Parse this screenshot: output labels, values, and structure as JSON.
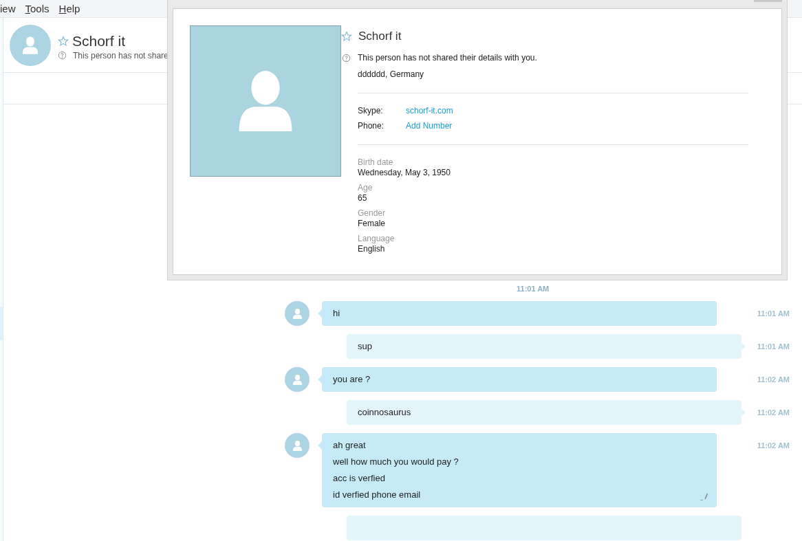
{
  "menu": [
    {
      "label": "iew",
      "mnemonic": false
    },
    {
      "label": "Tools",
      "mnemonic": true
    },
    {
      "label": "Help",
      "mnemonic": true
    }
  ],
  "contact_header": {
    "name": "Schorf it",
    "status": "This person has not share"
  },
  "profile_dialog": {
    "name": "Schorf it",
    "status": "This person has not shared their details with you.",
    "location": "dddddd, Germany",
    "accounts": [
      {
        "label": "Skype:",
        "value": "schorf-it.com"
      },
      {
        "label": "Phone:",
        "value": "Add Number"
      }
    ],
    "details": [
      {
        "label": "Birth date",
        "value": "Wednesday, May 3, 1950"
      },
      {
        "label": "Age",
        "value": "65"
      },
      {
        "label": "Gender",
        "value": "Female"
      },
      {
        "label": "Language",
        "value": "English"
      }
    ]
  },
  "chat": {
    "day_time": "11:01 AM",
    "messages": [
      {
        "kind": "incoming",
        "lines": [
          "hi"
        ],
        "time": "11:01 AM",
        "edited": false
      },
      {
        "kind": "outgoing",
        "lines": [
          "sup"
        ],
        "time": "11:01 AM",
        "edited": false
      },
      {
        "kind": "incoming",
        "lines": [
          "you are ?"
        ],
        "time": "11:02 AM",
        "edited": false
      },
      {
        "kind": "outgoing",
        "lines": [
          "coinnosaurus"
        ],
        "time": "11:02 AM",
        "edited": false
      },
      {
        "kind": "incoming",
        "lines": [
          "ah great",
          "well how much you would pay ?",
          "acc is verfied",
          "id verfied phone email"
        ],
        "time": "11:02 AM",
        "edited": true
      },
      {
        "kind": "outgoing",
        "edited": false
      }
    ]
  }
}
